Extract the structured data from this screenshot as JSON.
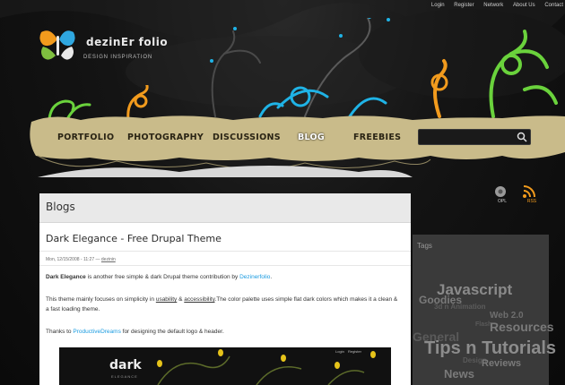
{
  "top_links": [
    "Login",
    "Register",
    "Network",
    "About Us",
    "Contact"
  ],
  "logo": {
    "name": "dezinEr folio",
    "subtitle": "DESIGN INSPIRATION"
  },
  "nav": {
    "items": [
      "PORTFOLIO",
      "PHOTOGRAPHY",
      "DISCUSSIONS",
      "BLOG",
      "FREEBIES"
    ],
    "active": "BLOG"
  },
  "search": {
    "value": ""
  },
  "side_icons": [
    {
      "label": "OPL"
    },
    {
      "label": "RSS"
    }
  ],
  "blog": {
    "heading": "Blogs",
    "post_title": "Dark Elegance - Free Drupal Theme",
    "meta_prefix": "Mon, 12/15/2008 - 11:27 — ",
    "meta_author": "dezinin",
    "p1_bold": "Dark Elegance",
    "p1_text": " is another free simple & dark Drupal theme contribution by ",
    "p1_link": "Dezinerfolio",
    "p1_end": ".",
    "p2_start": "This theme mainly focuses on simplicity in ",
    "p2_link1": "usability",
    "p2_mid": " & ",
    "p2_link2": "accessibility",
    "p2_end": ".The color palette uses simple flat dark colors which makes it a clean & a fast loading theme.",
    "p3_start": "Thanks to ",
    "p3_link": "ProductiveDreams",
    "p3_end": " for designing  the default logo & header.",
    "preview_logo_top": "dark",
    "preview_logo_bottom": "ELEGANCE",
    "preview_links": [
      "Login",
      "Register"
    ]
  },
  "tags": {
    "title": "Tags",
    "items": [
      "Javascript",
      "Goodies",
      "3d n Animation",
      "Web 2.0",
      "Flash",
      "Resources",
      "General",
      "Tips n Tutorials",
      "Design",
      "Reviews",
      "News"
    ]
  },
  "colors": {
    "link_blue": "#1a9be0",
    "nav_khaki": "#c9bb8a",
    "tag_grey": "#6e6e6e"
  }
}
